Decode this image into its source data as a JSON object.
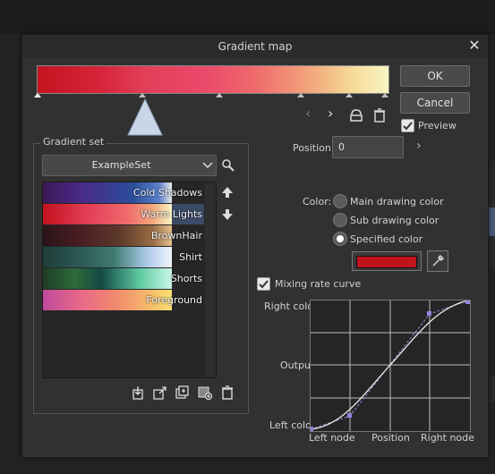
{
  "dialog": {
    "title": "Gradient map",
    "ok_label": "OK",
    "cancel_label": "Cancel",
    "preview_label": "Preview",
    "preview_checked": true
  },
  "gradient": {
    "colors": [
      "#c4131f",
      "#e23e58",
      "#ef6a6c",
      "#f2a77b",
      "#f9f5c4"
    ]
  },
  "position": {
    "label": "Position:",
    "value": "0"
  },
  "gradient_set": {
    "title": "Gradient set",
    "selected": "ExampleSet",
    "items": [
      {
        "label": "Cold Shadows"
      },
      {
        "label": "Warm Lights"
      },
      {
        "label": "BrownHair"
      },
      {
        "label": "Shirt"
      },
      {
        "label": "Shorts"
      },
      {
        "label": "Foreground"
      }
    ]
  },
  "color": {
    "label": "Color:",
    "options": [
      "Main drawing color",
      "Sub drawing color",
      "Specified color"
    ],
    "selected": "Specified color",
    "swatch": "#c0141c"
  },
  "mixing": {
    "label": "Mixing rate curve",
    "checked": true,
    "right_color": "Right color",
    "output": "Output",
    "left_color": "Left color",
    "left_node": "Left node",
    "position_axis": "Position",
    "right_node": "Right node"
  }
}
